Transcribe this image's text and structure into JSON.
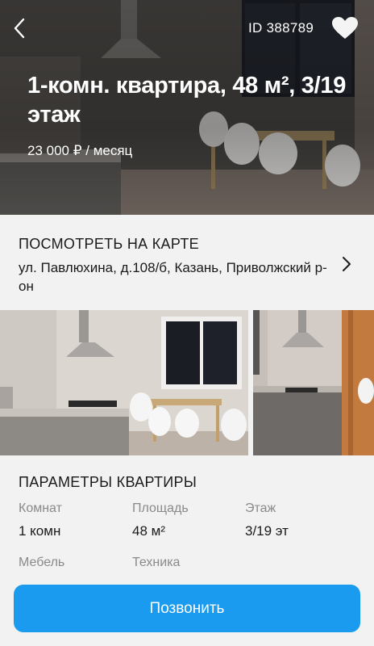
{
  "hero": {
    "listing_id": "ID 388789",
    "title": "1-комн. квартира, 48 м², 3/19 этаж",
    "price": "23 000 ₽ / месяц"
  },
  "map": {
    "heading": "ПОСМОТРЕТЬ НА КАРТЕ",
    "address": "ул. Павлюхина, д.108/б, Казань, Приволжский р-он"
  },
  "gallery": {
    "photo_count_visible": 2
  },
  "params": {
    "heading": "ПАРАМЕТРЫ КВАРТИРЫ",
    "items": [
      {
        "label": "Комнат",
        "value": "1 комн"
      },
      {
        "label": "Площадь",
        "value": "48 м²"
      },
      {
        "label": "Этаж",
        "value": "3/19 эт"
      },
      {
        "label": "Мебель",
        "value": ""
      },
      {
        "label": "Техника",
        "value": ""
      }
    ]
  },
  "actions": {
    "call_label": "Позвонить"
  },
  "colors": {
    "accent": "#1a9bf0",
    "background": "#f2f2f2",
    "muted_text": "#8a8a8a"
  },
  "icons": [
    "back-chevron-icon",
    "heart-icon",
    "chevron-right-icon"
  ]
}
